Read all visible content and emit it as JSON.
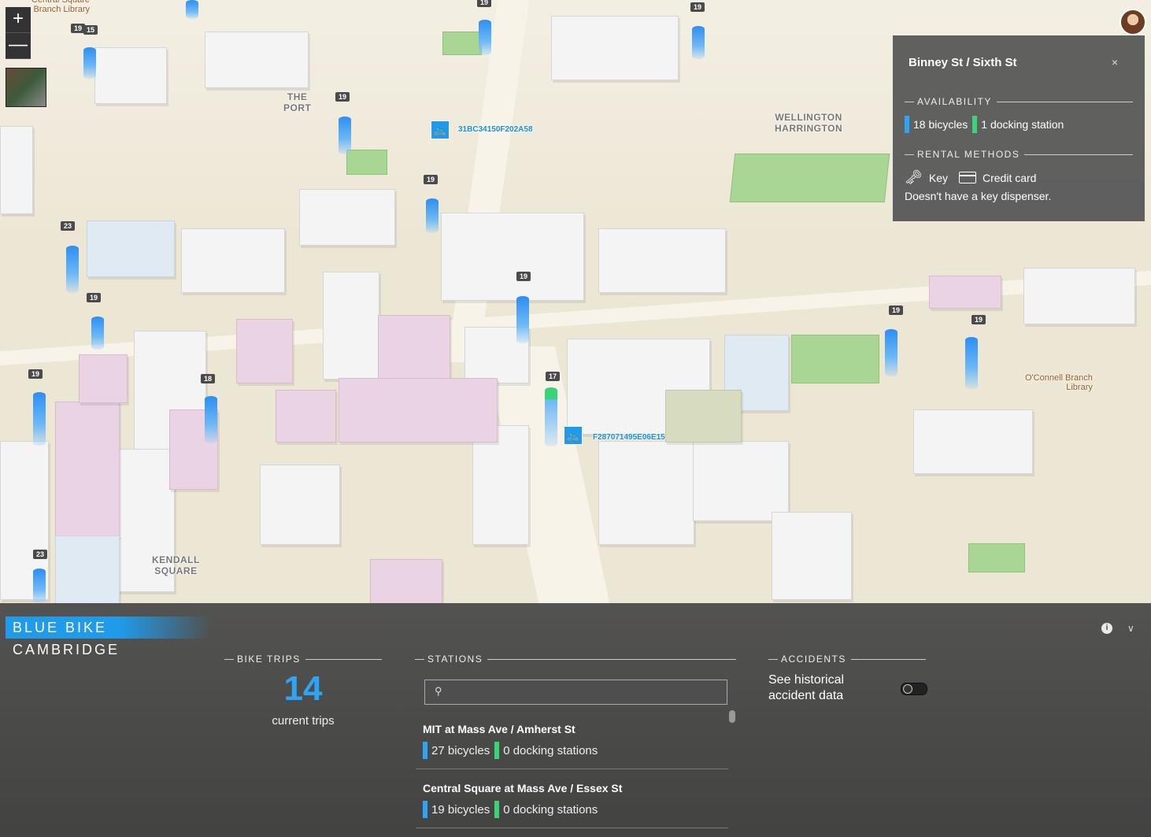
{
  "map": {
    "zoom_in": "+",
    "zoom_out": "—",
    "places": {
      "the_port": "THE\nPORT",
      "wellington": "WELLINGTON\nHARRINGTON",
      "kendall": "KENDALL\nSQUARE",
      "central_library": "Central Square\nBranch Library",
      "oconnell_library": "O'Connell Branch\nLibrary"
    },
    "station_labels": [
      "15",
      "19",
      "19",
      "19",
      "23",
      "19",
      "19",
      "18",
      "19",
      "17",
      "19",
      "19",
      "23",
      "19",
      "19"
    ],
    "bikes": [
      {
        "id": "31BC34150F202A58"
      },
      {
        "id": "F287071495E06E15"
      }
    ]
  },
  "popup": {
    "title": "Binney St / Sixth St",
    "close": "×",
    "availability_header": "AVAILABILITY",
    "bicycles": "18 bicycles",
    "docking": "1 docking station",
    "rental_header": "RENTAL METHODS",
    "key": "Key",
    "credit_card": "Credit card",
    "note": "Doesn't have a key dispenser."
  },
  "panel": {
    "app_title": "BLUE BIKE CAMBRIDGE",
    "bike_trips_header": "BIKE TRIPS",
    "trip_count": "14",
    "trip_sub": "current trips",
    "stations_header": "STATIONS",
    "search_placeholder": "",
    "stations": [
      {
        "name": "MIT at Mass Ave / Amherst St",
        "bicycles": "27 bicycles",
        "docking": "0 docking stations"
      },
      {
        "name": "Central Square at Mass Ave / Essex St",
        "bicycles": "19 bicycles",
        "docking": "0 docking stations"
      }
    ],
    "accidents_header": "ACCIDENTS",
    "accidents_text": "See historical\naccident data",
    "accidents_toggle_on": false
  },
  "colors": {
    "accent_blue": "#2ea4f4",
    "docking_green": "#3cd27a"
  }
}
